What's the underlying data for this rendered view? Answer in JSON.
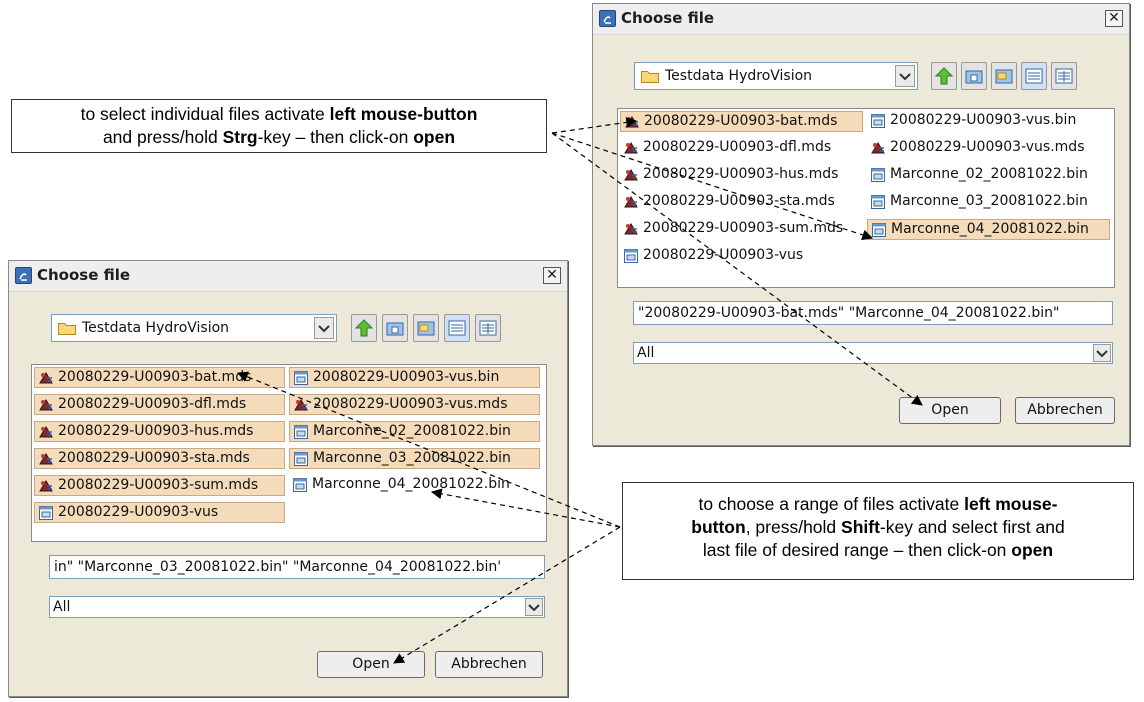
{
  "dialog_right": {
    "title": "Choose file",
    "folder": "Testdata HydroVision",
    "files": [
      {
        "name": "20080229-U00903-bat.mds",
        "type": "mds",
        "selected": true
      },
      {
        "name": "20080229-U00903-dfl.mds",
        "type": "mds",
        "selected": false
      },
      {
        "name": "20080229-U00903-hus.mds",
        "type": "mds",
        "selected": false
      },
      {
        "name": "20080229-U00903-sta.mds",
        "type": "mds",
        "selected": false
      },
      {
        "name": "20080229-U00903-sum.mds",
        "type": "mds",
        "selected": false
      },
      {
        "name": "20080229-U00903-vus",
        "type": "bin",
        "selected": false
      },
      {
        "name": "20080229-U00903-vus.bin",
        "type": "bin",
        "selected": false
      },
      {
        "name": "20080229-U00903-vus.mds",
        "type": "mds",
        "selected": false
      },
      {
        "name": "Marconne_02_20081022.bin",
        "type": "bin",
        "selected": false
      },
      {
        "name": "Marconne_03_20081022.bin",
        "type": "bin",
        "selected": false
      },
      {
        "name": "Marconne_04_20081022.bin",
        "type": "bin",
        "selected": true
      }
    ],
    "filename_value": "\"20080229-U00903-bat.mds\" \"Marconne_04_20081022.bin\"",
    "filter_value": "All",
    "open_label": "Open",
    "cancel_label": "Abbrechen"
  },
  "dialog_left": {
    "title": "Choose file",
    "folder": "Testdata HydroVision",
    "files": [
      {
        "name": "20080229-U00903-bat.mds",
        "type": "mds",
        "selected": true
      },
      {
        "name": "20080229-U00903-dfl.mds",
        "type": "mds",
        "selected": true
      },
      {
        "name": "20080229-U00903-hus.mds",
        "type": "mds",
        "selected": true
      },
      {
        "name": "20080229-U00903-sta.mds",
        "type": "mds",
        "selected": true
      },
      {
        "name": "20080229-U00903-sum.mds",
        "type": "mds",
        "selected": true
      },
      {
        "name": "20080229-U00903-vus",
        "type": "bin",
        "selected": true
      },
      {
        "name": "20080229-U00903-vus.bin",
        "type": "bin",
        "selected": true
      },
      {
        "name": "20080229-U00903-vus.mds",
        "type": "mds",
        "selected": true
      },
      {
        "name": "Marconne_02_20081022.bin",
        "type": "bin",
        "selected": true
      },
      {
        "name": "Marconne_03_20081022.bin",
        "type": "bin",
        "selected": true
      },
      {
        "name": "Marconne_04_20081022.bin",
        "type": "bin",
        "selected": false
      }
    ],
    "filename_value": "in\" \"Marconne_03_20081022.bin\" \"Marconne_04_20081022.bin'",
    "filter_value": "All",
    "open_label": "Open",
    "cancel_label": "Abbrechen"
  },
  "note_top": {
    "line1_a": "to select individual files activate ",
    "line1_b": "left mouse-button",
    "line2_a": "and press/hold ",
    "line2_b": "Strg",
    "line2_c": "-key – then click-on ",
    "line2_d": "open"
  },
  "note_bottom": {
    "l1_a": "to choose a range of files activate ",
    "l1_b": "left mouse-",
    "l2_a": "button",
    "l2_b": ", press/hold ",
    "l2_c": "Shift",
    "l2_d": "-key and select first and",
    "l3_a": "last file of desired range  – then click-on ",
    "l3_b": "open"
  }
}
